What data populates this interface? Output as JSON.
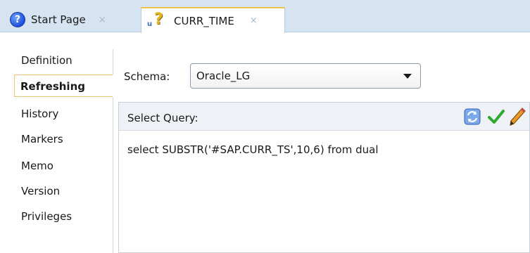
{
  "tabs": [
    {
      "label": "Start Page",
      "close": "×",
      "icon": "help-icon"
    },
    {
      "label": "CURR_TIME",
      "close": "×",
      "icon": "variable-icon"
    }
  ],
  "nav": {
    "items": [
      "Definition",
      "Refreshing",
      "History",
      "Markers",
      "Memo",
      "Version",
      "Privileges"
    ],
    "active": "Refreshing"
  },
  "schema": {
    "label": "Schema:",
    "value": "Oracle_LG"
  },
  "query": {
    "title": "Select Query:",
    "text": "select SUBSTR('#SAP.CURR_TS',10,6) from dual",
    "icons": [
      "refresh-icon",
      "validate-check-icon",
      "edit-pencil-icon"
    ]
  },
  "colors": {
    "tabbar": "#d6e4f1",
    "active_tab_accent": "#f0c24a",
    "check": "#2fa92f",
    "pencil": "#e08a1a"
  }
}
